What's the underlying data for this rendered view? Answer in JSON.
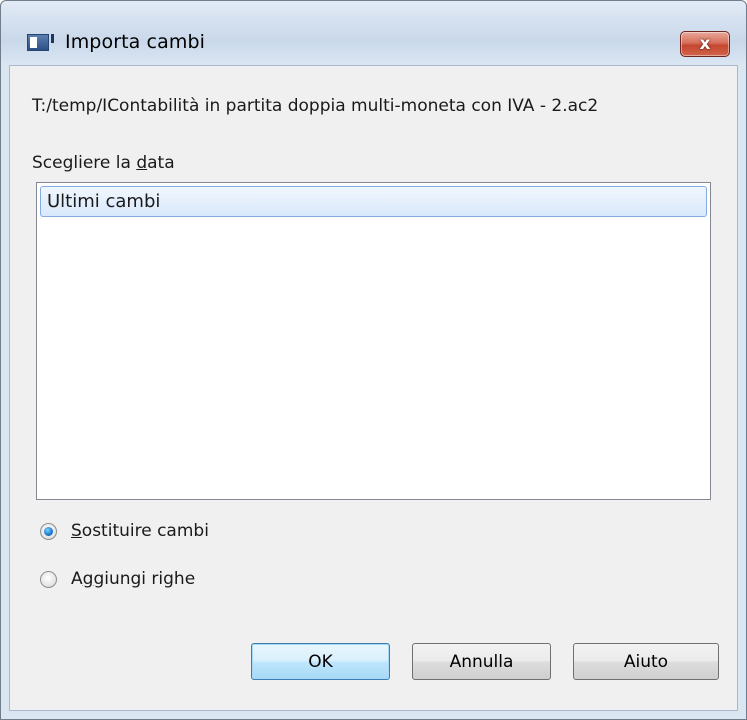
{
  "window": {
    "title": "Importa cambi",
    "close_glyph": "x"
  },
  "dialog": {
    "path": "T:/temp/IContabilità in partita doppia multi-moneta con IVA - 2.ac2",
    "list_label_prefix": "Scegliere la ",
    "list_label_mnemonic": "d",
    "list_label_suffix": "ata",
    "list_items": [
      {
        "label": "Ultimi cambi",
        "selected": true
      }
    ],
    "options": {
      "replace": {
        "mnemonic": "S",
        "rest": "ostituire cambi",
        "checked": true
      },
      "add": {
        "prefix": "A",
        "mnemonic": "g",
        "rest": "giungi righe",
        "checked": false
      }
    }
  },
  "buttons": {
    "ok": "OK",
    "cancel": "Annulla",
    "help": "Aiuto"
  },
  "colors": {
    "selection": "#d8e8fb",
    "close_button": "#c4482f",
    "default_button_border": "#3c7fb1"
  },
  "icons": {
    "app": "app-window-icon",
    "close": "close-icon"
  }
}
